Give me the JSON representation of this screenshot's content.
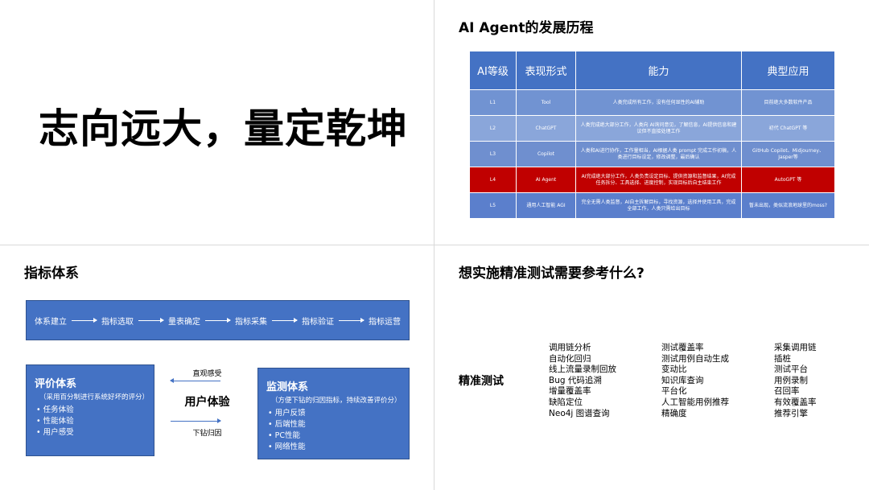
{
  "slide1": {
    "slogan": "志向远大，量定乾坤"
  },
  "slide2": {
    "title": "AI Agent的发展历程",
    "headers": [
      "AI等级",
      "表现形式",
      "能力",
      "典型应用"
    ],
    "rows": [
      {
        "level": "L1",
        "form": "Tool",
        "ability": "人类完成所有工作，没有任何显性的AI辅助",
        "app": "目前绝大多数软件产品"
      },
      {
        "level": "L2",
        "form": "ChatGPT",
        "ability": "人类完成绝大部分工作，人类向 AI询问意见，了解信息，AI提供信息和建议但不直接处理工作",
        "app": "初代 ChatGPT 等"
      },
      {
        "level": "L3",
        "form": "Copilot",
        "ability": "人类和AI进行协作，工作量相当，AI根据人类 prompt 完成工作初稿，人类进行目标设定，修改调整，最后确认",
        "app": "GitHub Copilot、Midjourney、Jasper等"
      },
      {
        "level": "L4",
        "form": "AI Agent",
        "ability": "AI完成绝大部分工作，人类负责设定目标、提供资源和监督结果，AI完成任务拆分、工具选择、进度控制，实现目标后自主结束工作",
        "app": "AutoGPT 等"
      },
      {
        "level": "L5",
        "form": "通用人工智能 AGI",
        "ability": "完全无需人类监督，AI自主拆解目标，寻找资源，选择并使用工具，完成全部工作，人类只需给出目标",
        "app": "暂未出现，类似流浪地球里的moss?"
      }
    ]
  },
  "slide3": {
    "title": "指标体系",
    "flow": [
      "体系建立",
      "指标选取",
      "量表确定",
      "指标采集",
      "指标验证",
      "指标运营"
    ],
    "left_box": {
      "title": "评价体系",
      "sub": "（采用百分制进行系统好坏的评分）",
      "items": [
        "任务体验",
        "性能体验",
        "用户感受"
      ]
    },
    "center": {
      "label": "用户体验",
      "top_label": "直观感受",
      "bottom_label": "下钻归因"
    },
    "right_box": {
      "title": "监测体系",
      "sub": "（方便下钻的归因指标，持续改善评价分）",
      "items": [
        "用户反馈",
        "后端性能",
        "PC性能",
        "网络性能"
      ]
    }
  },
  "slide4": {
    "title": "想实施精准测试需要参考什么?",
    "label": "精准测试",
    "col1": [
      "调用链分析",
      "自动化回归",
      "线上流量录制回放",
      "Bug 代码追溯",
      "增量覆盖率",
      "缺陷定位",
      "Neo4j 图谱查询"
    ],
    "col2": [
      "测试覆盖率",
      "测试用例自动生成",
      "变动比",
      "知识库查询",
      "平台化",
      "人工智能用例推荐",
      "精确度"
    ],
    "col3": [
      "采集调用链",
      "插桩",
      "测试平台",
      "用例录制",
      "召回率",
      "有效覆盖率",
      "推荐引擎"
    ]
  }
}
